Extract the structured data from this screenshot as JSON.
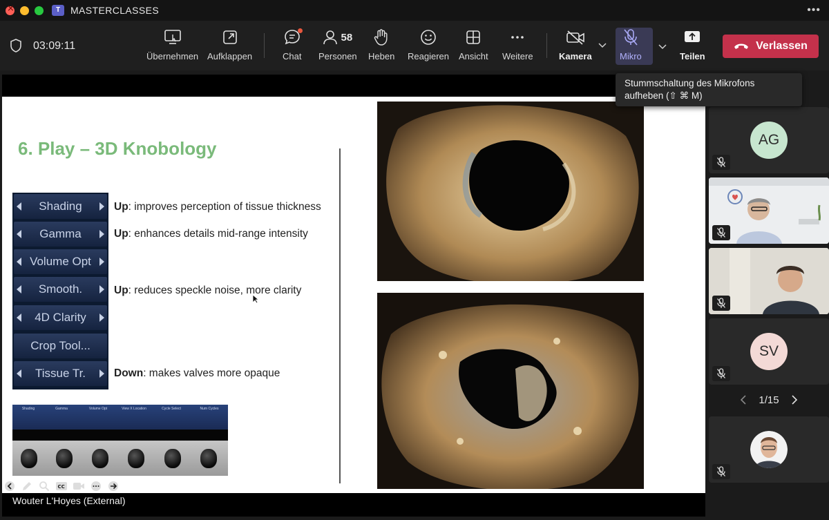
{
  "window": {
    "title": "MASTERCLASSES"
  },
  "toolbar": {
    "timer": "03:09:11",
    "buttons": {
      "share_take": "Übernehmen",
      "popout": "Aufklappen",
      "chat": "Chat",
      "people": "Personen",
      "people_count": "58",
      "raise": "Heben",
      "react": "Reagieren",
      "view": "Ansicht",
      "more": "Weitere",
      "camera": "Kamera",
      "mic": "Mikro",
      "share": "Teilen"
    },
    "leave_label": "Verlassen",
    "chat_has_unread": true,
    "accent_leave": "#c4314b"
  },
  "tooltip": {
    "text": "Stummschaltung des Mikrofons aufheben (⇧ ⌘ M)"
  },
  "slide": {
    "title": "6. Play – 3D Knobology",
    "knobs": [
      "Shading",
      "Gamma",
      "Volume Opt",
      "Smooth.",
      "4D Clarity",
      "Crop Tool...",
      "Tissue Tr."
    ],
    "descriptions": [
      {
        "keyword": "Up",
        "rest": ": improves perception of tissue thickness"
      },
      {
        "keyword": "Up",
        "rest": ": enhances details mid-range intensity"
      },
      {
        "keyword": "Up",
        "rest": ": reduces speckle noise, more clarity"
      },
      {
        "keyword": "Down",
        "rest": ": makes valves more opaque"
      }
    ],
    "control_panel_labels": [
      "Shading",
      "Gamma",
      "Volume Opt",
      "View X Location",
      "Cycle Select",
      "Num Cycles"
    ]
  },
  "presenter": {
    "name": "Wouter L'Hoyes (External)"
  },
  "participants": {
    "tiles": [
      {
        "initials": "AG",
        "color": "#c7e6cf"
      },
      {
        "initials": "",
        "type": "video-1"
      },
      {
        "initials": "",
        "type": "video-2"
      },
      {
        "initials": "SV",
        "color": "#f3d9d6"
      },
      {
        "initials": "",
        "type": "photo"
      }
    ],
    "pager": "1/15"
  }
}
